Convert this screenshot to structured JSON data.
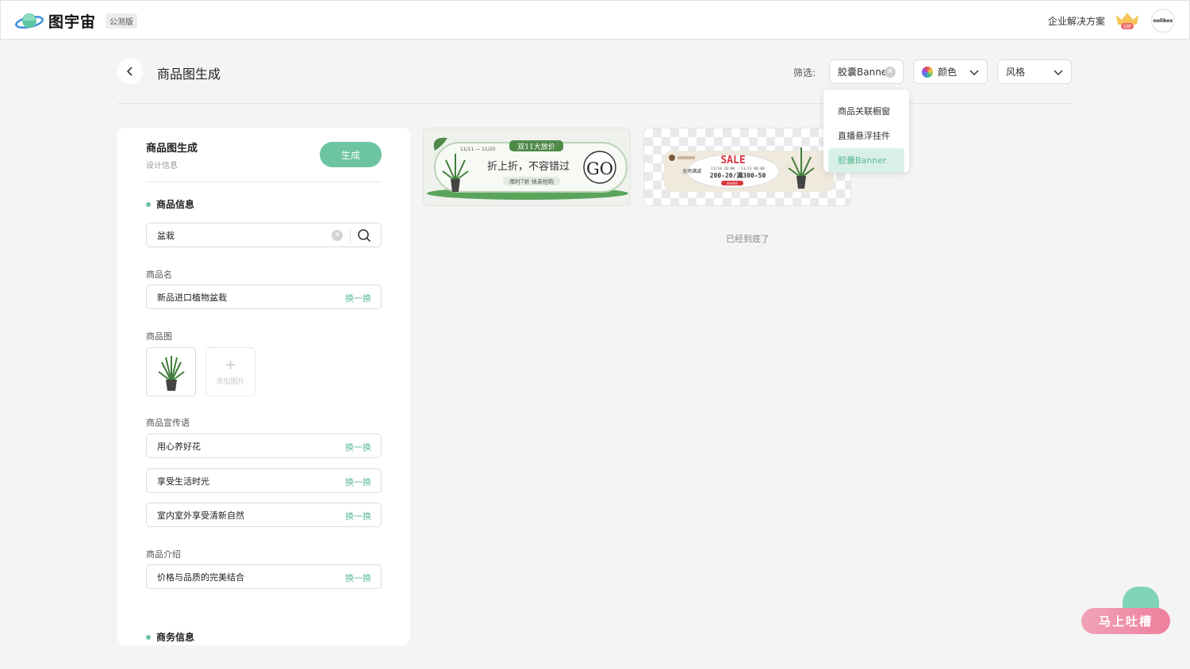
{
  "app": {
    "name": "图宇宙",
    "badge": "公测版"
  },
  "topbar": {
    "enterprise_link": "企业解决方案",
    "vip_label": "VIP",
    "avatar_text": "nolibox"
  },
  "header": {
    "title": "商品图生成",
    "filter_label": "筛选:",
    "filters": {
      "banner": "胶囊Banner",
      "color": "颜色",
      "style": "风格"
    }
  },
  "dropdown": {
    "items": [
      "商品关联橱窗",
      "直播悬浮挂件",
      "胶囊Banner"
    ],
    "selected": "胶囊Banner"
  },
  "panel": {
    "title": "商品图生成",
    "subtitle": "设计信息",
    "generate_label": "生成",
    "product_section": "商品信息",
    "search_value": "盆栽",
    "name_label": "商品名",
    "name_value": "新品进口植物盆栽",
    "swap_label": "换一换",
    "image_label": "商品图",
    "add_image_label": "添加图片",
    "slogan_label": "商品宣传语",
    "slogans": [
      "用心养好花",
      "享受生活时光",
      "室内室外享受清新自然"
    ],
    "intro_label": "商品介绍",
    "intro_value": "价格与品质的完美结合",
    "business_section": "商务信息"
  },
  "cards": [
    {
      "date": "11/11 — 11/20",
      "tag": "双11大放价",
      "headline": "折上折，不容错过",
      "cta": "GO",
      "sub": "限时7折 快来抢购"
    },
    {
      "sale": "SALE",
      "time": "11/10 20:00 - 11/13 00:00",
      "promo": "200-20/满300-50",
      "side": "全场满减",
      "btn": "前往购买"
    }
  ],
  "end_text": "已经到底了",
  "feedback": "马上吐槽",
  "colors": {
    "accent": "#6cc4a1",
    "accent_text": "#5bb995",
    "feedback_pink": "#ee7f9c"
  }
}
